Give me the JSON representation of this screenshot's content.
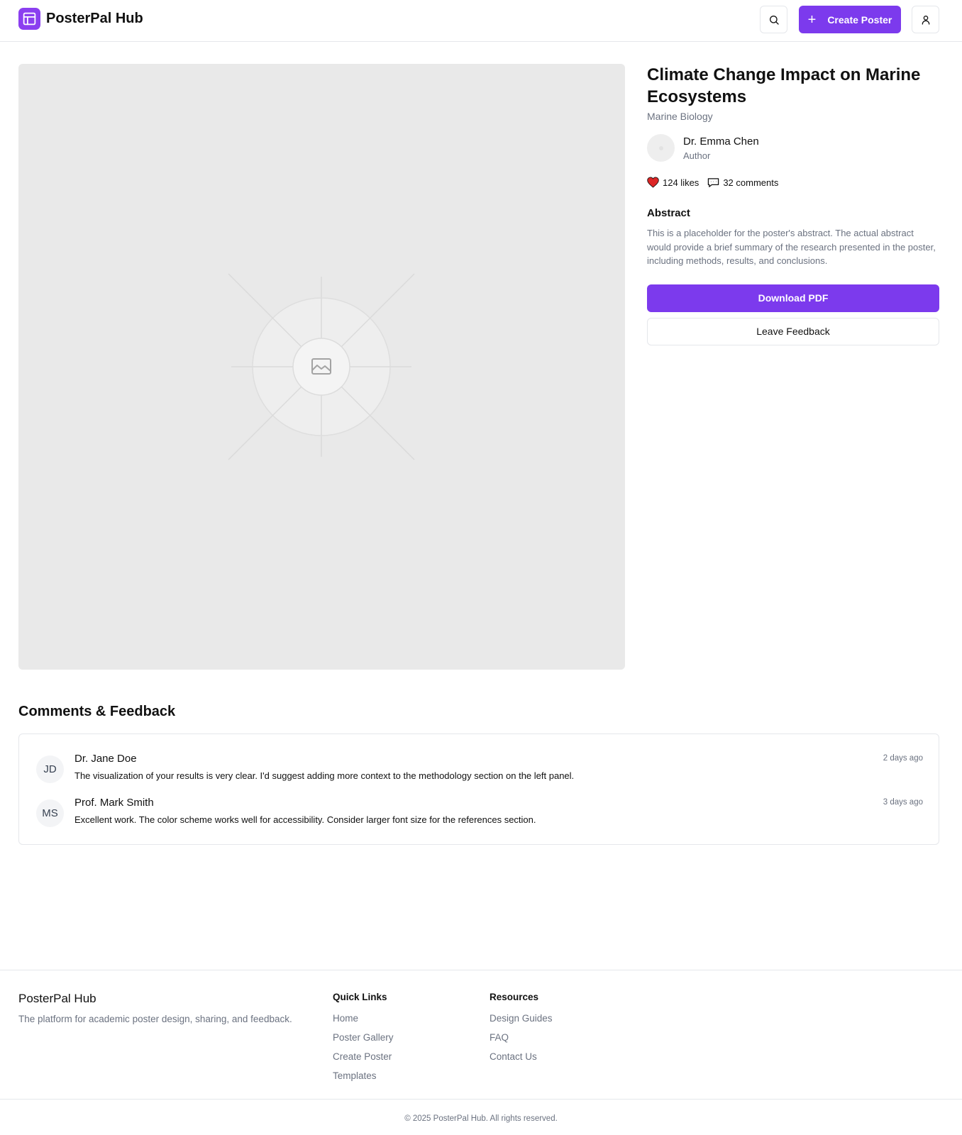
{
  "header": {
    "brand": "PosterPal Hub",
    "create_label": "Create Poster",
    "search_icon": "search-icon",
    "user_icon": "user-icon",
    "accent_color": "#7c3aed"
  },
  "poster": {
    "title": "Climate Change Impact on Marine Ecosystems",
    "category": "Marine Biology",
    "placeholder_icon": "image-icon",
    "author": {
      "name": "Dr. Emma Chen",
      "role": "Author"
    },
    "likes": "124 likes",
    "comments": "32 comments",
    "abstract_heading": "Abstract",
    "abstract_text": "This is a placeholder for the poster's abstract. The actual abstract would provide a brief summary of the research presented in the poster, including methods, results, and conclusions.",
    "download_label": "Download PDF",
    "feedback_label": "Leave Feedback"
  },
  "comments_section": {
    "heading": "Comments & Feedback",
    "items": [
      {
        "initials": "JD",
        "name": "Dr. Jane Doe",
        "time": "2 days ago",
        "text": "The visualization of your results is very clear. I'd suggest adding more context to the methodology section on the left panel."
      },
      {
        "initials": "MS",
        "name": "Prof. Mark Smith",
        "time": "3 days ago",
        "text": "Excellent work. The color scheme works well for accessibility. Consider larger font size for the references section."
      }
    ]
  },
  "footer": {
    "brand": "PosterPal Hub",
    "tagline": "The platform for academic poster design, sharing, and feedback.",
    "quick_links": {
      "heading": "Quick Links",
      "links": [
        "Home",
        "Poster Gallery",
        "Create Poster",
        "Templates"
      ]
    },
    "resources": {
      "heading": "Resources",
      "links": [
        "Design Guides",
        "FAQ",
        "Contact Us"
      ]
    },
    "copyright": "© 2025 PosterPal Hub. All rights reserved."
  }
}
